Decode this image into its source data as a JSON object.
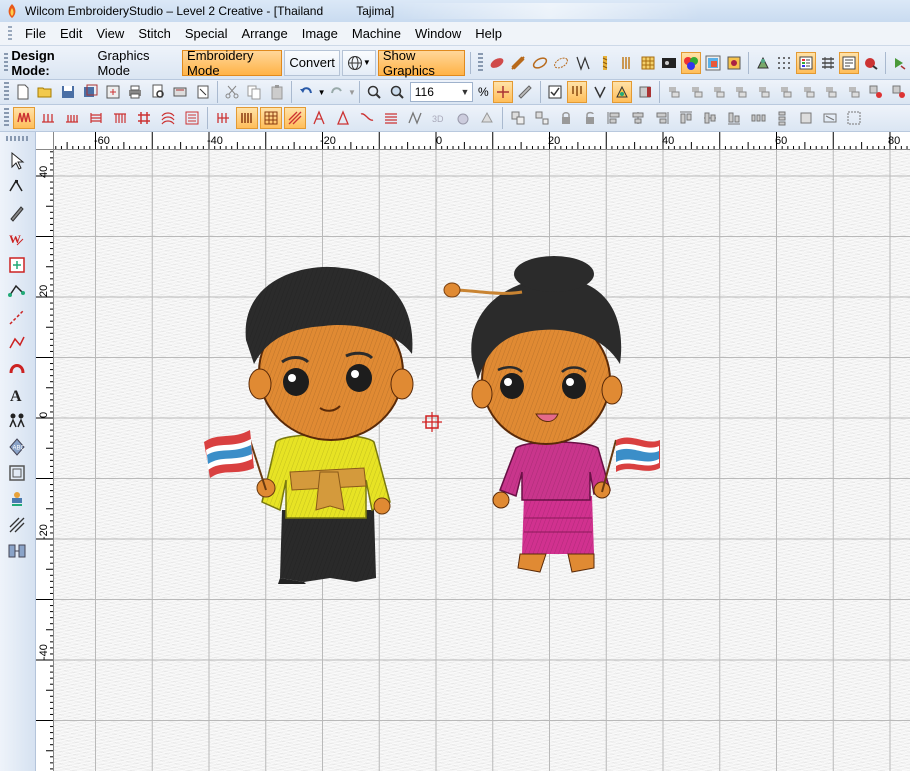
{
  "window": {
    "title": "Wilcom EmbroideryStudio – Level 2 Creative - [Thailand          Tajima]"
  },
  "menu": [
    "File",
    "Edit",
    "View",
    "Stitch",
    "Special",
    "Arrange",
    "Image",
    "Machine",
    "Window",
    "Help"
  ],
  "design_mode": {
    "label": "Design Mode:",
    "graphics_mode": "Graphics Mode",
    "embroidery_mode": "Embroidery Mode",
    "convert": "Convert",
    "show_graphics": "Show Graphics",
    "active_mode": "Embroidery Mode"
  },
  "zoom": {
    "value": "116",
    "unit": "%"
  },
  "rulers": {
    "horizontal": [
      "-60",
      "-40",
      "-20",
      "0",
      "20",
      "40",
      "60",
      "80"
    ],
    "vertical": [
      "40",
      "20",
      "0",
      "-20",
      "-40"
    ]
  },
  "colors": {
    "accent_active": "#ffb347",
    "toolbar_bg": "#dfe9f5",
    "boy_shirt": "#e5e022",
    "girl_outfit": "#d1318f",
    "skin": "#e08a33",
    "hair": "#2b2b2b"
  },
  "icons": {
    "left_toolbar": [
      "select-arrow-icon",
      "reshape-icon",
      "digitize-pen-icon",
      "monogram-icon",
      "stitch-edit-icon",
      "node-edit-icon",
      "run-line-icon",
      "input-line-icon",
      "arc-icon",
      "lettering-icon",
      "team-names-icon",
      "monogramming-icon",
      "appliqué-icon",
      "decorative-stamp-icon",
      "fill-line-icon",
      "stitch-player-icon"
    ]
  }
}
